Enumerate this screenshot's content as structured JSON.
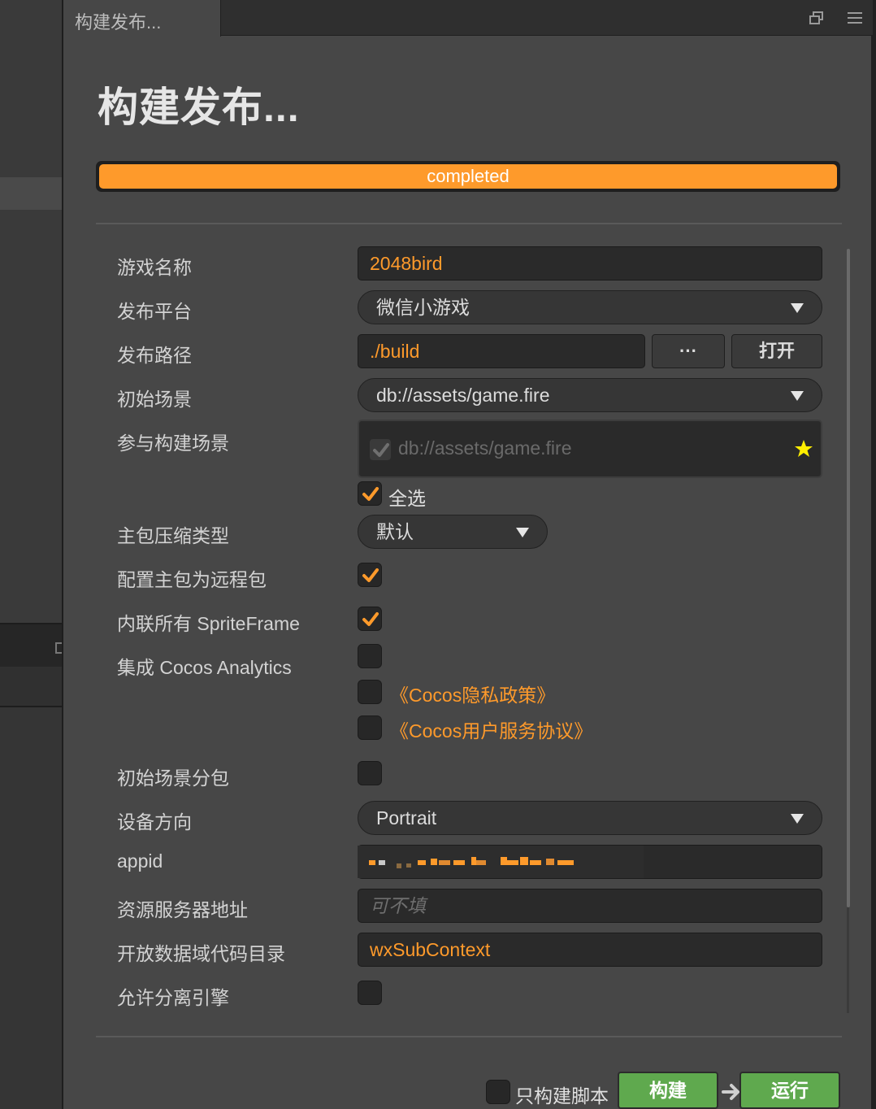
{
  "window": {
    "tab_title": "构建发布...",
    "heading": "构建发布..."
  },
  "progress": {
    "status": "completed",
    "value": 1.0,
    "color": "#fe9a2b"
  },
  "form": {
    "game_name": {
      "label": "游戏名称",
      "value": "2048bird"
    },
    "platform": {
      "label": "发布平台",
      "value": "微信小游戏"
    },
    "build_path": {
      "label": "发布路径",
      "value": "./build",
      "browse_label": "···",
      "open_label": "打开"
    },
    "start_scene": {
      "label": "初始场景",
      "value": "db://assets/game.fire"
    },
    "included_scenes": {
      "label": "参与构建场景",
      "items": [
        {
          "name": "db://assets/game.fire",
          "checked": true,
          "is_start": true
        }
      ],
      "select_all_label": "全选",
      "select_all_checked": true
    },
    "main_compression": {
      "label": "主包压缩类型",
      "value": "默认"
    },
    "main_remote": {
      "label": "配置主包为远程包",
      "checked": true
    },
    "inline_spriteframe": {
      "label": "内联所有 SpriteFrame",
      "checked": true
    },
    "cocos_analytics": {
      "label": "集成 Cocos Analytics",
      "checked": false,
      "privacy_label": "《Cocos隐私政策》",
      "privacy_checked": false,
      "service_label": "《Cocos用户服务协议》",
      "service_checked": false
    },
    "start_scene_subpackage": {
      "label": "初始场景分包",
      "checked": false
    },
    "orientation": {
      "label": "设备方向",
      "value": "Portrait"
    },
    "appid": {
      "label": "appid"
    },
    "remote_server": {
      "label": "资源服务器地址",
      "placeholder": "可不填"
    },
    "open_data_context": {
      "label": "开放数据域代码目录",
      "value": "wxSubContext"
    },
    "separate_engine": {
      "label": "允许分离引擎",
      "checked": false
    }
  },
  "footer": {
    "build_script_only_label": "只构建脚本",
    "build_script_only_checked": false,
    "build_label": "构建",
    "run_label": "运行"
  },
  "colors": {
    "accent": "#fe9a2b",
    "panel_bg": "#474747",
    "field_bg": "#2a2a2a",
    "build_button": "#5fa94e",
    "star": "#ffee00"
  }
}
